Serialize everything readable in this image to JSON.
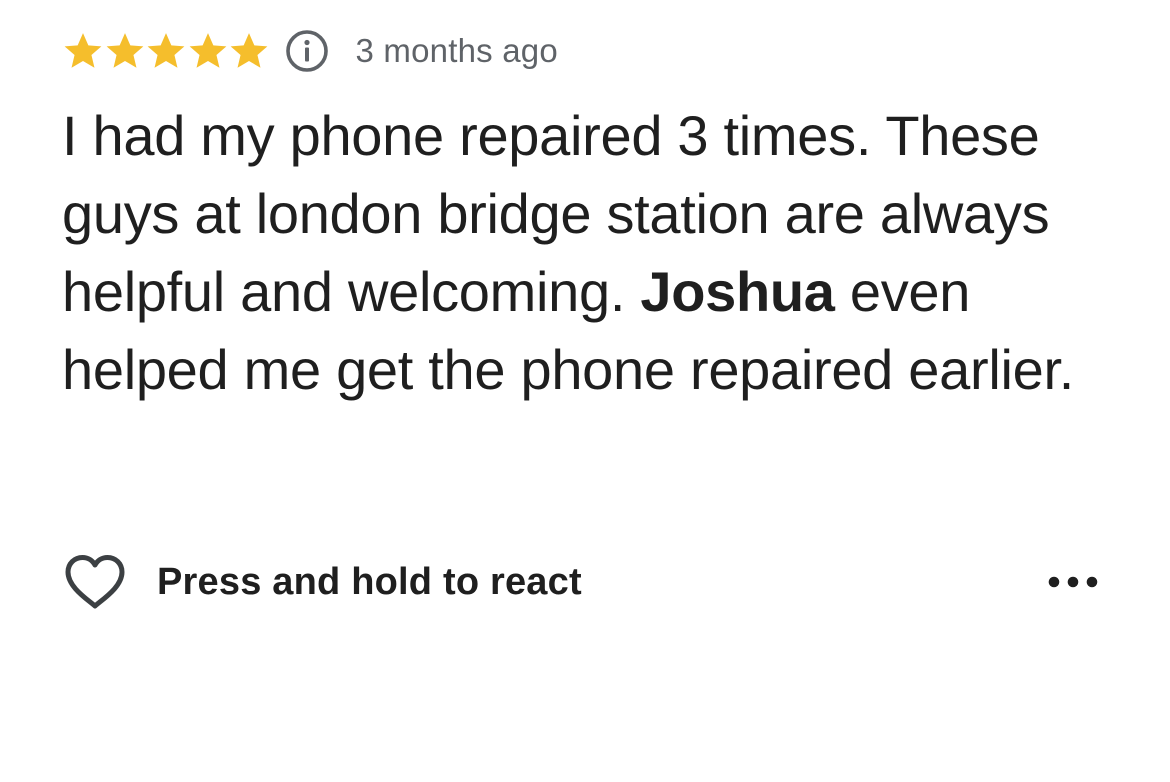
{
  "review": {
    "rating": 5,
    "max_rating": 5,
    "star_color": "#F5BE2C",
    "info_icon": "info-icon",
    "time_ago": "3 months ago",
    "text_before": "I had my phone repaired 3 times. These guys at london bridge station are always helpful and welcoming. ",
    "mention": "Joshua",
    "text_after": " even helped me get the phone repaired earlier."
  },
  "actions": {
    "react_icon": "heart-outline-icon",
    "react_label": "Press and hold to react",
    "more_icon": "more-horizontal-icon"
  }
}
